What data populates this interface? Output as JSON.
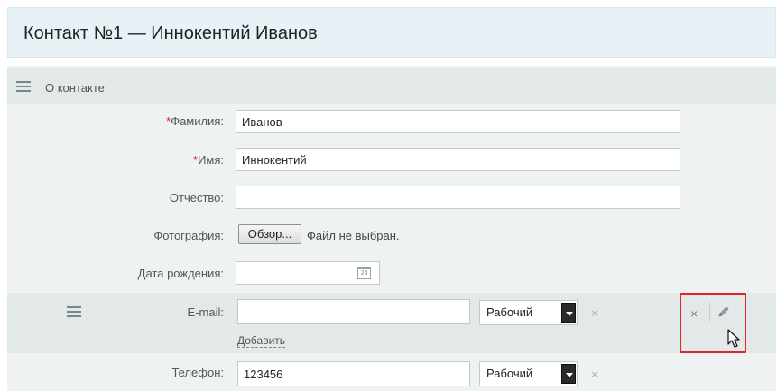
{
  "header": {
    "title": "Контакт №1 — Иннокентий Иванов"
  },
  "section": {
    "label": "О контакте"
  },
  "fields": {
    "surname": {
      "label": "Фамилия:",
      "required_mark": "*",
      "value": "Иванов"
    },
    "name": {
      "label": "Имя:",
      "required_mark": "*",
      "value": "Иннокентий"
    },
    "patronymic": {
      "label": "Отчество:",
      "value": ""
    },
    "photo": {
      "label": "Фотография:",
      "button_label": "Обзор...",
      "status": "Файл не выбран."
    },
    "birthdate": {
      "label": "Дата рождения:",
      "value": "",
      "calendar_day": "24"
    },
    "email": {
      "label": "E-mail:",
      "value": "",
      "type": "Рабочий",
      "add_label": "Добавить"
    },
    "phone": {
      "label": "Телефон:",
      "value": "123456",
      "type": "Рабочий"
    }
  },
  "icons": {
    "remove": "×",
    "delete": "×"
  },
  "colors": {
    "highlight": "#e0262b",
    "required": "#d0262b",
    "title_bg": "#e7f1f6"
  }
}
